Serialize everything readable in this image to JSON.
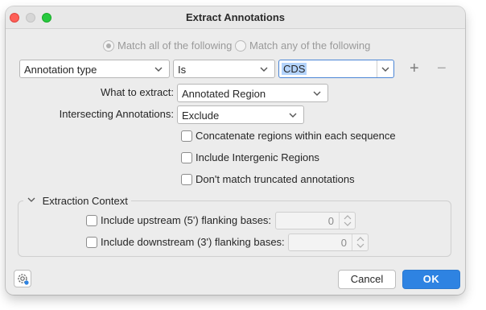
{
  "window": {
    "title": "Extract Annotations"
  },
  "match": {
    "all_label": "Match all of the following",
    "any_label": "Match any of the following",
    "selected": "all"
  },
  "filter": {
    "field": "Annotation type",
    "operator": "Is",
    "value": "CDS",
    "add_symbol": "+",
    "remove_symbol": "−"
  },
  "extract": {
    "label": "What to extract:",
    "value": "Annotated Region"
  },
  "intersecting": {
    "label": "Intersecting Annotations:",
    "value": "Exclude"
  },
  "options": [
    {
      "label": "Concatenate regions within each sequence",
      "checked": false
    },
    {
      "label": "Include Intergenic Regions",
      "checked": false
    },
    {
      "label": "Don't match truncated annotations",
      "checked": false
    }
  ],
  "context": {
    "title": "Extraction Context",
    "upstream": {
      "label": "Include upstream (5') flanking bases:",
      "value": "0",
      "checked": false
    },
    "downstream": {
      "label": "Include downstream (3') flanking bases:",
      "value": "0",
      "checked": false
    }
  },
  "buttons": {
    "cancel": "Cancel",
    "ok": "OK"
  },
  "icons": {
    "settings": "gear-icon",
    "dropdown": "chevron-down-icon",
    "collapse": "chevron-down-icon",
    "stepper": "stepper-arrows-icon"
  },
  "colors": {
    "accent": "#2e83e2",
    "selection": "#b3d3fb"
  }
}
